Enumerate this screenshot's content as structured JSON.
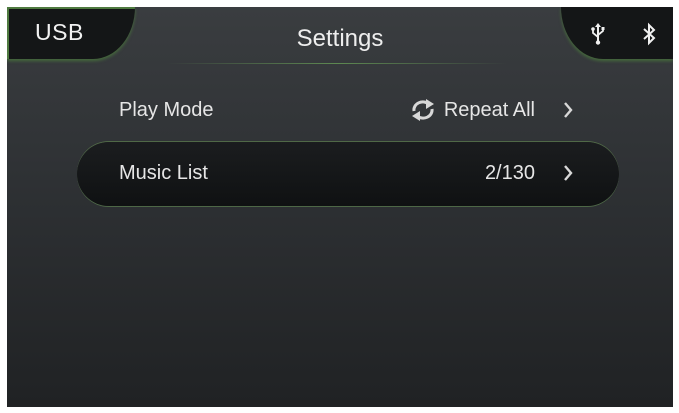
{
  "header": {
    "source_label": "USB",
    "title": "Settings",
    "icons": [
      "usb-icon",
      "bluetooth-icon"
    ]
  },
  "menu": {
    "items": [
      {
        "label": "Play Mode",
        "value": "Repeat All",
        "icon": "repeat-icon",
        "selected": false
      },
      {
        "label": "Music List",
        "value": "2/130",
        "selected": true
      }
    ]
  },
  "colors": {
    "accent_glow": "#6fa85a",
    "background": "#2f3235",
    "selected_row": "#141617",
    "text": "#e6e6e6"
  }
}
